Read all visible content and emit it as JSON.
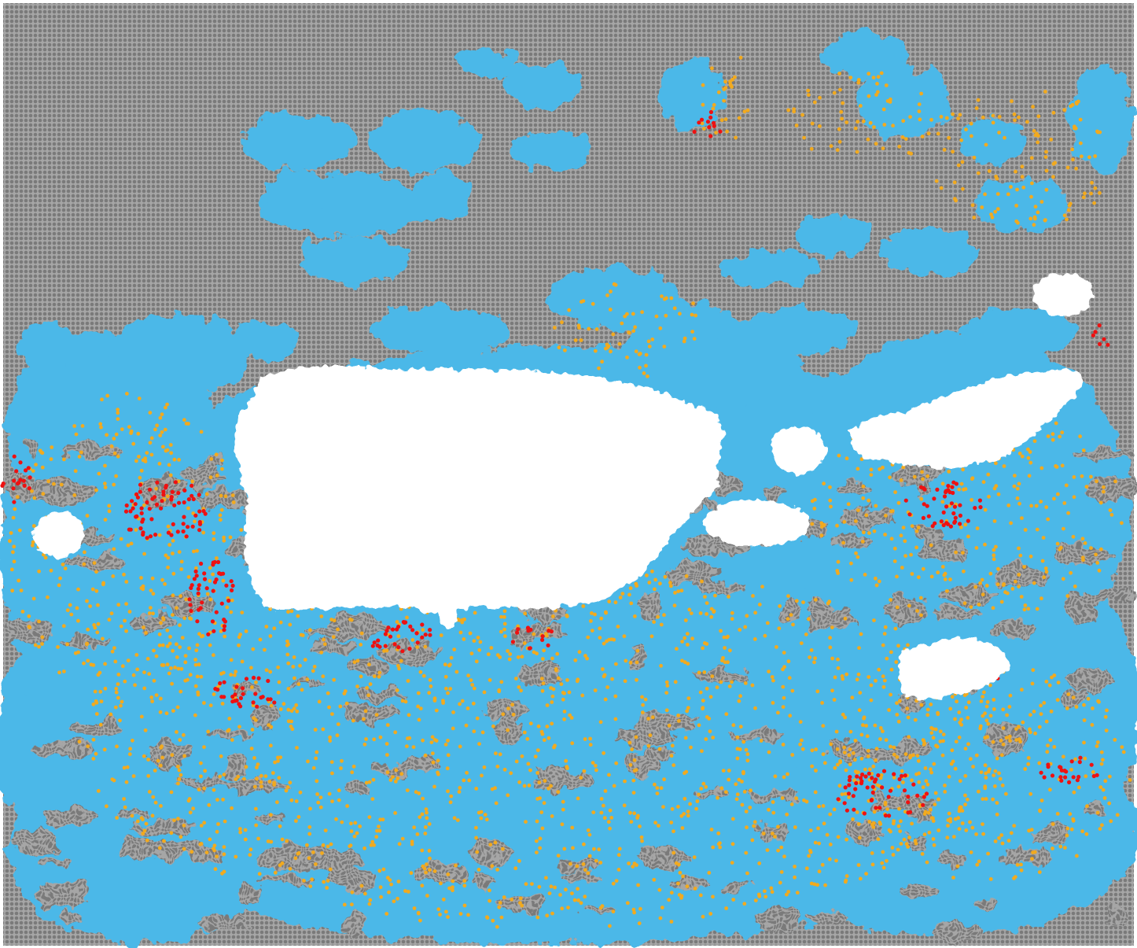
{
  "map": {
    "type": "dot-grid-category-map",
    "colors": {
      "background": "#808080",
      "water": "#4cb8e8",
      "medium": "#f2aa1e",
      "high": "#ee1111",
      "land": "#ffffff"
    },
    "categories": [
      "background",
      "water",
      "medium",
      "high",
      "land"
    ],
    "landmasses": [
      "main-island",
      "west-island",
      "south-islet",
      "east-islet-1",
      "east-islet-2",
      "east-island-long",
      "northeast-islet",
      "southeast-island"
    ]
  }
}
